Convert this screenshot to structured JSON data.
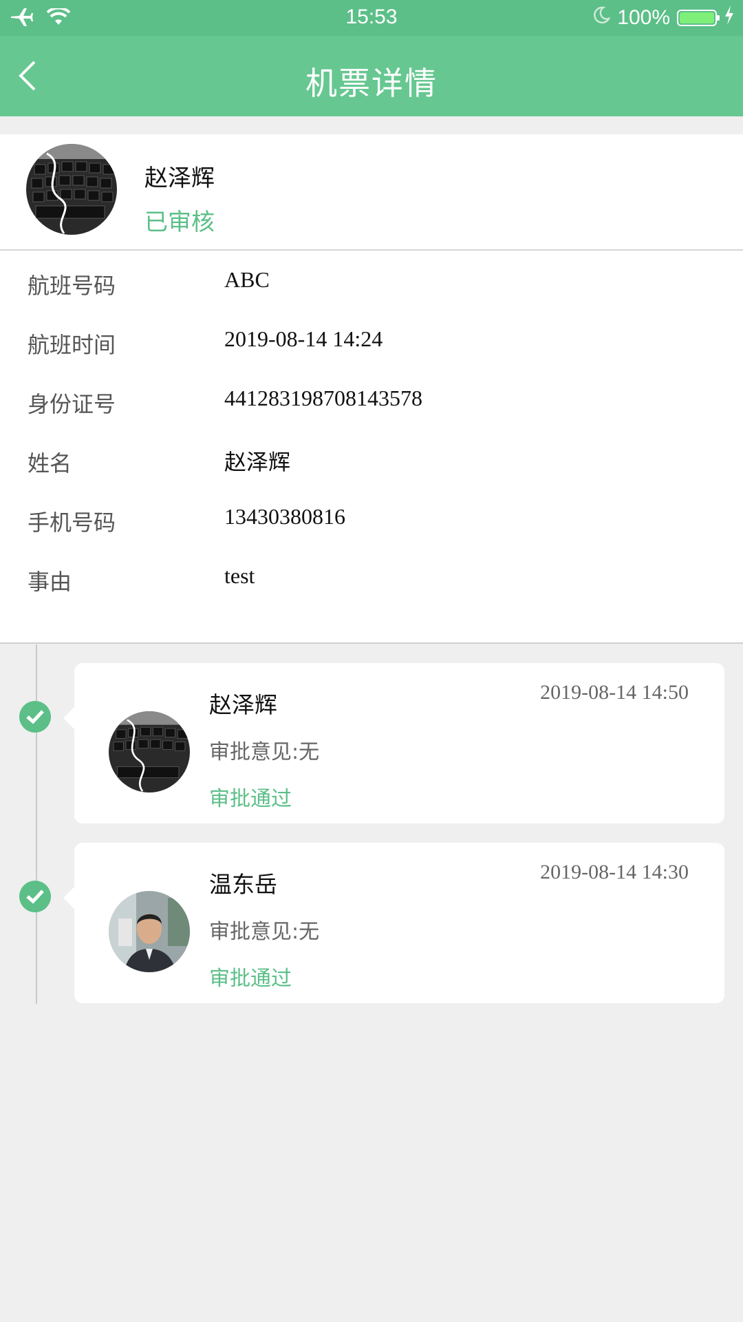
{
  "status_bar": {
    "time": "15:53",
    "battery": "100%",
    "battery_level": 1.0
  },
  "nav": {
    "title": "机票详情"
  },
  "applicant": {
    "name": "赵泽辉",
    "status": "已审核"
  },
  "details": [
    {
      "label": "航班号码",
      "value": "ABC"
    },
    {
      "label": "航班时间",
      "value": "2019-08-14 14:24"
    },
    {
      "label": "身份证号",
      "value": "441283198708143578"
    },
    {
      "label": "姓名",
      "value": "赵泽辉"
    },
    {
      "label": "手机号码",
      "value": "13430380816"
    },
    {
      "label": "事由",
      "value": "test"
    }
  ],
  "approvals": [
    {
      "name": "赵泽辉",
      "time": "2019-08-14 14:50",
      "opinion": "审批意见:无",
      "result": "审批通过"
    },
    {
      "name": "温东岳",
      "time": "2019-08-14 14:30",
      "opinion": "审批意见:无",
      "result": "审批通过"
    }
  ],
  "colors": {
    "primary": "#5cbf88",
    "nav": "#66c791",
    "background": "#efefef"
  }
}
